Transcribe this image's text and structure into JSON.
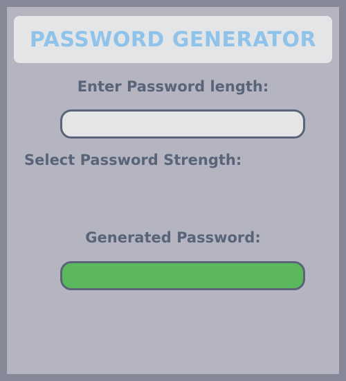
{
  "app": {
    "title": "PASSWORD GENERATOR"
  },
  "length": {
    "label": "Enter Password length:",
    "value": "",
    "placeholder": ""
  },
  "strength": {
    "label": "Select Password Strength:"
  },
  "generated": {
    "label": "Generated Password:",
    "value": ""
  },
  "colors": {
    "background": "#868898",
    "panel": "#b4b5c0",
    "header_bg": "#e3e5e6",
    "title": "#8fc3ea",
    "label_text": "#5a6478",
    "input_bg": "#e3e5e6",
    "generated_bg": "#5cb85c"
  }
}
